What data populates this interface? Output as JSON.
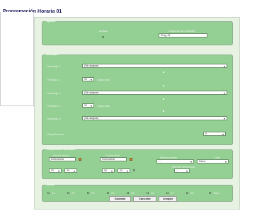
{
  "page": {
    "title": "Programación Horaria 01"
  },
  "sections": {
    "general": {
      "legend": "Ajustes",
      "activate_label": "Activar",
      "tag_label": "Etiqueta del mensaje",
      "tag_value": "Prog. 01"
    },
    "messages": {
      "legend": "Mensajes",
      "message1_label": "Mensaje 1:",
      "message2_label": "Mensaje 2:",
      "message3_label": "Mensaje 3:",
      "message_value": "(Sin asignar)",
      "delay1_label": "Retardo 1:",
      "delay2_label": "Retardo 2:",
      "delay_value": "00",
      "delay_unit": "Segundos",
      "repeat_label": "Repeticiones:",
      "repeat_value": "0"
    },
    "calendar": {
      "legend": "Programación calendario",
      "start_date_label": "Fecha inicial",
      "end_date_label": "Fecha final",
      "start_date": "01/01/2016",
      "end_date": "01/01/2016",
      "start_hour": "00",
      "start_min": "00",
      "end_hour": "00",
      "end_min": "00",
      "restrictions_label": "Restricciones",
      "restrictions_value": "---",
      "days_label": "Días",
      "days_value": "Diario",
      "sequential_label": "Repetir secuencia",
      "sequential_value": "---"
    },
    "zones": {
      "legend": "Zonas",
      "items": [
        "Z1",
        "Z2",
        "Z3",
        "Z4",
        "Z5",
        "Z6",
        "Z7",
        "Z8",
        "Todo"
      ]
    }
  },
  "buttons": {
    "save": "Guardar",
    "cancel": "Cancelar",
    "clear": "Limpiar"
  },
  "colors": {
    "section_bg": "#94cf94",
    "panel_bg": "#e7f2e3",
    "title": "#1a1a5c"
  }
}
